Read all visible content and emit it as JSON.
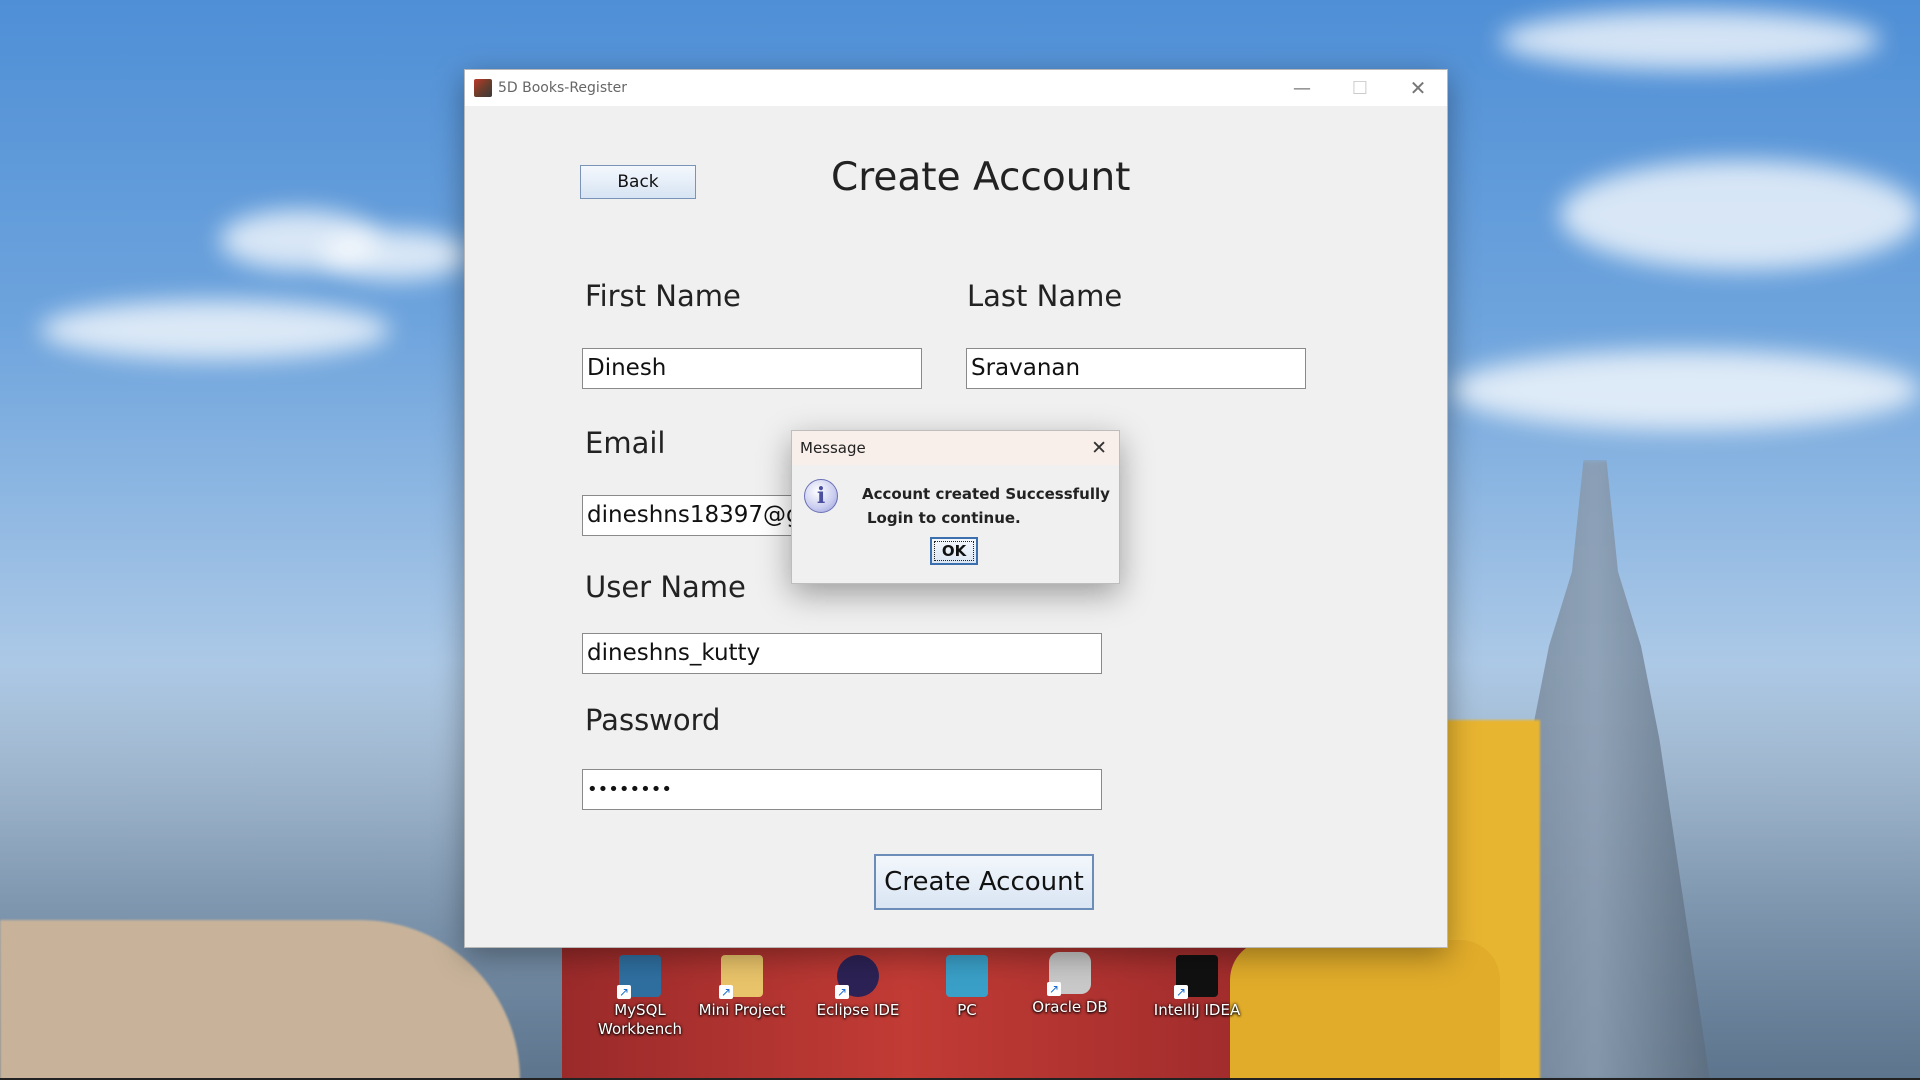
{
  "window": {
    "title": "5D Books-Register",
    "controls": {
      "minimize": "—",
      "maximize": "☐",
      "close": "✕"
    }
  },
  "form": {
    "back_label": "Back",
    "heading": "Create Account",
    "first_name_label": "First Name",
    "first_name_value": "Dinesh",
    "last_name_label": "Last Name",
    "last_name_value": "Sravanan",
    "email_label": "Email",
    "email_value": "dineshns18397@gm",
    "username_label": "User Name",
    "username_value": "dineshns_kutty",
    "password_label": "Password",
    "password_value": "••••••••",
    "create_label": "Create Account"
  },
  "dialog": {
    "title": "Message",
    "close": "✕",
    "icon": "i",
    "line1": "Account created Successfully",
    "line2": "Login to continue.",
    "ok_label": "OK"
  },
  "desktop": {
    "icons": [
      {
        "name": "mysql-workbench-icon",
        "line1": "MySQL",
        "line2": "Workbench",
        "color": "#2f6fa0"
      },
      {
        "name": "mini-project-icon",
        "line1": "Mini Project",
        "line2": "",
        "color": "#e9c46a"
      },
      {
        "name": "eclipse-ide-icon",
        "line1": "Eclipse IDE",
        "line2": "",
        "color": "#2c2255"
      },
      {
        "name": "pc-icon",
        "line1": "PC",
        "line2": "",
        "color": "#3aa0c8"
      },
      {
        "name": "oracle-db-icon",
        "line1": "Oracle DB",
        "line2": "",
        "color": "#c9c9c9"
      },
      {
        "name": "intellij-idea-icon",
        "line1": "IntelliJ IDEA",
        "line2": "",
        "color": "#111111"
      }
    ],
    "shortcut_arrow": "↗"
  }
}
